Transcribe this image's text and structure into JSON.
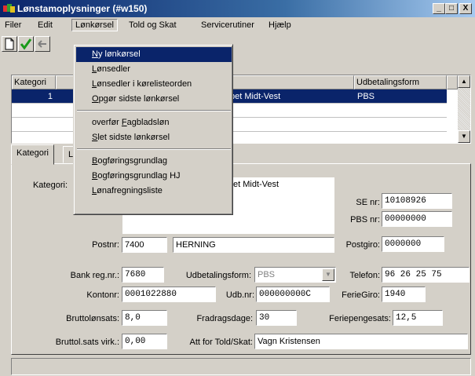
{
  "window": {
    "title": "Lønstamoplysninger (#w150)",
    "minimize": "_",
    "maximize": "□",
    "close": "X"
  },
  "menubar": [
    "Filer",
    "Edit",
    "Lønkørsel",
    "Told og Skat",
    "Servicerutiner",
    "Hjælp"
  ],
  "dropdown": {
    "items": [
      {
        "key": "N",
        "rest": "y lønkørsel",
        "pre": ""
      },
      {
        "key": "L",
        "rest": "ønsedler",
        "pre": ""
      },
      {
        "key": "L",
        "rest": "ønsedler i kørelisteorden",
        "pre": ""
      },
      {
        "key": "O",
        "rest": "pgør sidste lønkørsel",
        "pre": ""
      },
      {
        "key": "F",
        "rest": "agbladsløn",
        "pre": "overfør "
      },
      {
        "key": "S",
        "rest": "let sidste lønkørsel",
        "pre": ""
      },
      {
        "key": "B",
        "rest": "ogføringsgrundlag",
        "pre": ""
      },
      {
        "key": "B",
        "rest": "ogføringsgrundlag HJ",
        "pre": ""
      },
      {
        "key": "L",
        "rest": "ønafregningsliste",
        "pre": ""
      }
    ]
  },
  "grid": {
    "headers": {
      "kategori": "Kategori",
      "udbetalingsform": "Udbetalingsform"
    },
    "row": {
      "kategori": "1",
      "name_tail": "bet Midt-Vest",
      "udbetalingsform": "PBS"
    }
  },
  "tabs": {
    "kategori": "Kategori",
    "second_partial": "L"
  },
  "form": {
    "kategori_label": "Kategori:",
    "name_tail": "et Midt-Vest",
    "se_label": "SE nr:",
    "se_value": "10108926",
    "pbs_label": "PBS nr:",
    "pbs_value": "00000000",
    "postnr_label": "Postnr:",
    "postnr_value": "7400",
    "by_value": "HERNING",
    "postgiro_label": "Postgiro:",
    "postgiro_value": "0000000",
    "bankreg_label": "Bank reg.nr.:",
    "bankreg_value": "7680",
    "udbform_label": "Udbetalingsform:",
    "udbform_value": "PBS",
    "telefon_label": "Telefon:",
    "telefon_value": "96 26 25 75",
    "kontonr_label": "Kontonr:",
    "kontonr_value": "0001022880",
    "udbnr_label": "Udb.nr:",
    "udbnr_value": "000000000C",
    "feriegiro_label": "FerieGiro:",
    "feriegiro_value": "1940",
    "bruttolon_label": "Bruttolønsats:",
    "bruttolon_value": "8,0",
    "fradrag_label": "Fradragsdage:",
    "fradrag_value": "30",
    "feriepenge_label": "Feriepengesats:",
    "feriepenge_value": "12,5",
    "bruttolvirk_label": "Bruttol.sats virk.:",
    "bruttolvirk_value": "0,00",
    "att_label": "Att for Told/Skat:",
    "att_value": "Vagn Kristensen"
  },
  "colors": {
    "selection": "#0a246a",
    "face": "#d4d0c8"
  }
}
